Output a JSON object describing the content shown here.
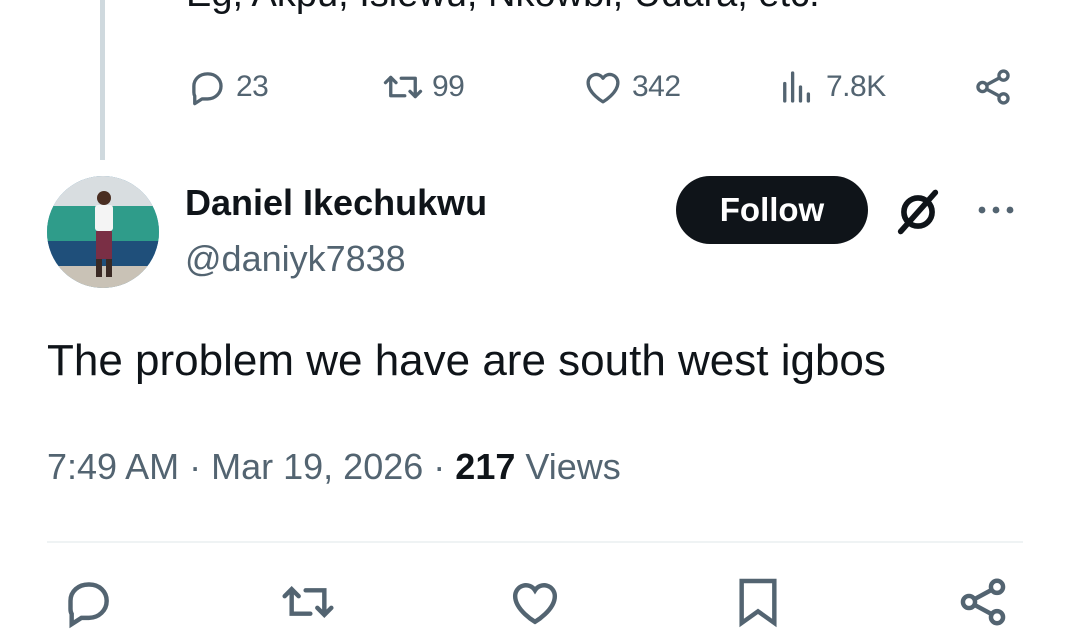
{
  "previous_tweet": {
    "text_fragment": "Eg, Akpu, Isiewu, Nkowbi, Udara, etc.",
    "actions": {
      "reply": {
        "icon": "reply-icon",
        "count": "23"
      },
      "retweet": {
        "icon": "retweet-icon",
        "count": "99"
      },
      "like": {
        "icon": "heart-icon",
        "count": "342"
      },
      "views": {
        "icon": "views-icon",
        "count": "7.8K"
      },
      "share": {
        "icon": "share-icon"
      }
    }
  },
  "tweet": {
    "author": {
      "name": "Daniel Ikechukwu",
      "handle": "@daniyk7838"
    },
    "follow_label": "Follow",
    "text": "The problem we have are south west igbos",
    "meta": {
      "time": "7:49 AM",
      "separator": "·",
      "date": "Mar 19, 2026",
      "views_count": "217",
      "views_label": "Views"
    }
  },
  "colors": {
    "text": "#0f1419",
    "secondary": "#536471",
    "follow_bg": "#0f1419",
    "divider": "#eff3f4",
    "thread_line": "#cfd9de"
  }
}
